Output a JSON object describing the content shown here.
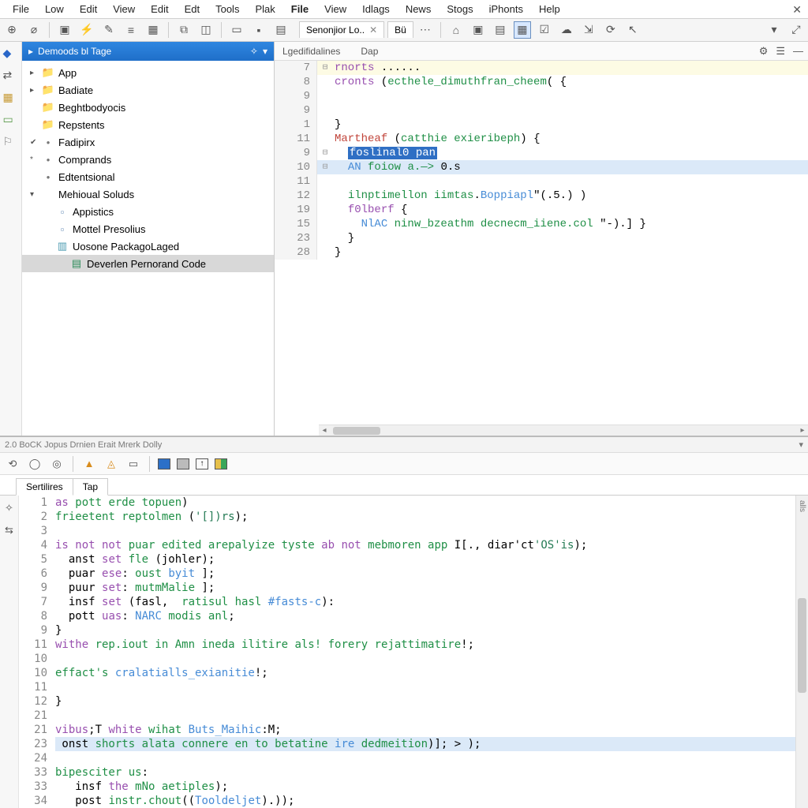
{
  "menu": [
    "File",
    "Low",
    "Edit",
    "View",
    "Edit",
    "Edt",
    "Tools",
    "Plak",
    "File",
    "View",
    "Idlags",
    "News",
    "Stogs",
    "iPhonts",
    "Help"
  ],
  "menu_bold_index": 8,
  "toolbar_tabs": [
    {
      "label": "Senonjior Lo..",
      "closable": true
    },
    {
      "label": "Bü",
      "closable": false
    }
  ],
  "tree_header": "Demoods bl Tage",
  "tree": [
    {
      "icon": "folder-blue",
      "label": "App",
      "tw": "▸",
      "ind": 0
    },
    {
      "icon": "folder-yellow",
      "label": "Badiate",
      "tw": "▸",
      "ind": 0
    },
    {
      "icon": "folder-yellow",
      "label": "Beghtbodyocis",
      "tw": "",
      "ind": 0
    },
    {
      "icon": "folder-yellow",
      "label": "Repstents",
      "tw": "",
      "ind": 0
    },
    {
      "icon": "dot",
      "label": "Fadipirx",
      "tw": "✔",
      "ind": 0
    },
    {
      "icon": "dot",
      "label": "Comprands",
      "tw": "*",
      "ind": 0
    },
    {
      "icon": "dot",
      "label": "Edtentsional",
      "tw": "",
      "ind": 0
    },
    {
      "icon": "none",
      "label": "Mehioual Soluds",
      "tw": "▾",
      "ind": 0
    },
    {
      "icon": "doc",
      "label": "Appistics",
      "tw": "",
      "ind": 1
    },
    {
      "icon": "doc",
      "label": "Mottel Presolius",
      "tw": "",
      "ind": 1
    },
    {
      "icon": "pkg",
      "label": "Uosone PackagoLaged",
      "tw": "",
      "ind": 1
    },
    {
      "icon": "code",
      "label": "Deverlen Pernorand Code",
      "tw": "",
      "ind": 2,
      "selected": true
    }
  ],
  "editor_tabs": [
    "Lgedifidalines",
    "Dap"
  ],
  "code_lines": [
    {
      "n": "7",
      "fold": "⊟",
      "cls": "hl-yellow",
      "tokens": [
        [
          "kw",
          "rnorts "
        ],
        [
          null,
          "......"
        ]
      ]
    },
    {
      "n": "8",
      "fold": "",
      "cls": "",
      "tokens": [
        [
          "kw",
          "cronts "
        ],
        [
          null,
          "("
        ],
        [
          "fn",
          "ecthele_dimuthfran_cheem"
        ],
        [
          null,
          "( {"
        ]
      ]
    },
    {
      "n": "9",
      "fold": "",
      "cls": "",
      "tokens": []
    },
    {
      "n": "9",
      "fold": "",
      "cls": "",
      "tokens": []
    },
    {
      "n": "1",
      "fold": "",
      "cls": "",
      "tokens": [
        [
          null,
          "}"
        ]
      ]
    },
    {
      "n": "11",
      "fold": "",
      "cls": "",
      "tokens": [
        [
          "red",
          "Martheaf "
        ],
        [
          null,
          "("
        ],
        [
          "fn",
          "catthie exieribeph"
        ],
        [
          null,
          ") {"
        ]
      ]
    },
    {
      "n": "9",
      "fold": "⊟",
      "cls": "",
      "tokens": [
        [
          null,
          "  "
        ],
        [
          "sel",
          "foslinal0 pan"
        ]
      ]
    },
    {
      "n": "10",
      "fold": "⊟",
      "cls": "hl-blue",
      "tokens": [
        [
          null,
          "  "
        ],
        [
          "id",
          "AN "
        ],
        [
          "fn",
          "foiow a.—> "
        ],
        [
          null,
          "0.s"
        ]
      ]
    },
    {
      "n": "11",
      "fold": "",
      "cls": "",
      "tokens": []
    },
    {
      "n": "12",
      "fold": "",
      "cls": "",
      "tokens": [
        [
          null,
          "  "
        ],
        [
          "fn",
          "ilnptimellon iimtas"
        ],
        [
          null,
          "."
        ],
        [
          "id",
          "Boppiapl"
        ],
        [
          null,
          "\"(.5.) )"
        ]
      ]
    },
    {
      "n": "19",
      "fold": "",
      "cls": "",
      "tokens": [
        [
          null,
          "  "
        ],
        [
          "kw",
          "f0lberf "
        ],
        [
          null,
          "{"
        ]
      ]
    },
    {
      "n": "15",
      "fold": "",
      "cls": "",
      "tokens": [
        [
          null,
          "    "
        ],
        [
          "id",
          "NlAC "
        ],
        [
          "fn",
          "ninw_bzeathm decnecm_iiene.col"
        ],
        [
          null,
          " \"-).] }"
        ]
      ]
    },
    {
      "n": "23",
      "fold": "",
      "cls": "",
      "tokens": [
        [
          null,
          "  }"
        ]
      ]
    },
    {
      "n": "28",
      "fold": "",
      "cls": "",
      "tokens": [
        [
          null,
          "}"
        ]
      ]
    }
  ],
  "status_text": "2.0 BoCK Jopus Drnien Erait Mrerk Dolly",
  "lower_tabs": [
    "Sertilires",
    "Tap"
  ],
  "lower_lines": [
    {
      "n": "1",
      "cls": "",
      "tokens": [
        [
          "kw",
          "as "
        ],
        [
          "fn",
          "pott erde topuen"
        ],
        [
          null,
          ")"
        ]
      ]
    },
    {
      "n": "2",
      "cls": "",
      "tokens": [
        [
          "fn",
          "frieetent reptolmen "
        ],
        [
          null,
          "("
        ],
        [
          "str",
          "'[])rs"
        ],
        [
          null,
          ");"
        ]
      ]
    },
    {
      "n": "3",
      "cls": "",
      "tokens": []
    },
    {
      "n": "4",
      "cls": "",
      "tokens": [
        [
          "kw",
          "is not not "
        ],
        [
          "fn",
          "puar edited arepalyize tyste "
        ],
        [
          "kw",
          "ab not "
        ],
        [
          "fn",
          "mebmoren app "
        ],
        [
          null,
          "I[., diar'ct"
        ],
        [
          "str",
          "'OS'is"
        ],
        [
          null,
          ");"
        ]
      ]
    },
    {
      "n": "5",
      "cls": "",
      "tokens": [
        [
          null,
          "  anst "
        ],
        [
          "kw",
          "set "
        ],
        [
          "fn",
          "fle "
        ],
        [
          null,
          "(johler);"
        ]
      ]
    },
    {
      "n": "6",
      "cls": "",
      "tokens": [
        [
          null,
          "  puar "
        ],
        [
          "kw",
          "ese"
        ],
        [
          null,
          ": "
        ],
        [
          "fn",
          "oust "
        ],
        [
          "id",
          "byit "
        ],
        [
          null,
          "];"
        ]
      ]
    },
    {
      "n": "9",
      "cls": "",
      "tokens": [
        [
          null,
          "  puur "
        ],
        [
          "kw",
          "set"
        ],
        [
          null,
          ": "
        ],
        [
          "fn",
          "mutmMalie "
        ],
        [
          null,
          "];"
        ]
      ]
    },
    {
      "n": "7",
      "cls": "",
      "tokens": [
        [
          null,
          "  insf "
        ],
        [
          "kw",
          "set "
        ],
        [
          null,
          "(fasl,  "
        ],
        [
          "fn",
          "ratisul hasl "
        ],
        [
          "id",
          "#fasts-c"
        ],
        [
          null,
          "):"
        ]
      ]
    },
    {
      "n": "8",
      "cls": "",
      "tokens": [
        [
          null,
          "  pott "
        ],
        [
          "kw",
          "uas"
        ],
        [
          null,
          ": "
        ],
        [
          "id",
          "NARC "
        ],
        [
          "fn",
          "modis anl"
        ],
        [
          null,
          ";"
        ]
      ]
    },
    {
      "n": "9",
      "cls": "",
      "tokens": [
        [
          null,
          "}"
        ]
      ]
    },
    {
      "n": "11",
      "cls": "",
      "tokens": [
        [
          "kw",
          "withe "
        ],
        [
          "fn",
          "rep.iout in Amn ineda ilitire als! forery rejattimatire"
        ],
        [
          null,
          "!;"
        ]
      ]
    },
    {
      "n": "10",
      "cls": "",
      "tokens": []
    },
    {
      "n": "10",
      "cls": "",
      "tokens": [
        [
          "fn",
          "effact's "
        ],
        [
          "id",
          "cralatialls_exianitie"
        ],
        [
          null,
          "!;"
        ]
      ]
    },
    {
      "n": "11",
      "cls": "",
      "tokens": []
    },
    {
      "n": "12",
      "cls": "",
      "tokens": [
        [
          null,
          "}"
        ]
      ]
    },
    {
      "n": "21",
      "cls": "",
      "tokens": []
    },
    {
      "n": "21",
      "cls": "",
      "tokens": [
        [
          "kw",
          "vibus"
        ],
        [
          null,
          ";T "
        ],
        [
          "kw",
          "white "
        ],
        [
          "fn",
          "wihat "
        ],
        [
          "id",
          "Buts_Maihic"
        ],
        [
          null,
          ":M;"
        ]
      ]
    },
    {
      "n": "23",
      "cls": "hl",
      "tokens": [
        [
          null,
          " onst "
        ],
        [
          "fn",
          "shorts alata connere en to betatine "
        ],
        [
          "id",
          "ire "
        ],
        [
          "fn",
          "dedmeition"
        ],
        [
          null,
          ")]; > );"
        ]
      ]
    },
    {
      "n": "24",
      "cls": "",
      "tokens": []
    },
    {
      "n": "33",
      "cls": "",
      "tokens": [
        [
          "fn",
          "bipesciter us"
        ],
        [
          null,
          ":"
        ]
      ]
    },
    {
      "n": "33",
      "cls": "",
      "tokens": [
        [
          null,
          "   insf "
        ],
        [
          "kw",
          "the "
        ],
        [
          "fn",
          "mNo aetiples"
        ],
        [
          null,
          ");"
        ]
      ]
    },
    {
      "n": "34",
      "cls": "",
      "tokens": [
        [
          null,
          "   post "
        ],
        [
          "fn",
          "instr.chout"
        ],
        [
          null,
          "(("
        ],
        [
          "id",
          "Tooldeljet"
        ],
        [
          null,
          ").));"
        ]
      ]
    }
  ]
}
